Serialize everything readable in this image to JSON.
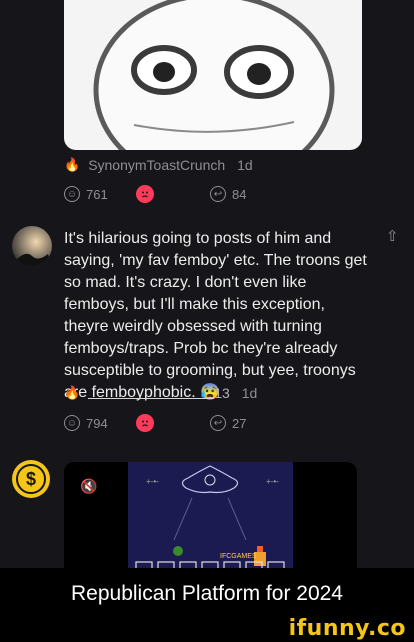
{
  "post1": {
    "username": "SynonymToastCrunch",
    "time": "1d",
    "likes": "761",
    "comments": "84"
  },
  "comment": {
    "text": "It's hilarious going to posts of him and saying, 'my fav femboy' etc. The troons get so mad. It's crazy. I don't even like femboys, but I'll make this exception, theyre weirdly obsessed with turning femboys/traps. Prob bc they're already susceptible to grooming, but yee, troonys are femboyphobic. 😰",
    "username_suffix": "13",
    "time": "1d",
    "likes": "794",
    "comments": "27"
  },
  "video": {
    "overlay_text": "IFCGAMES"
  },
  "caption": "Republican Platform for 2024",
  "watermark": "ifunny.co",
  "colors": {
    "background": "#16161a",
    "fire": "#f5a524",
    "unsmile": "#ff3b5c",
    "coin": "#f5c518",
    "watermark": "#f5c518"
  }
}
